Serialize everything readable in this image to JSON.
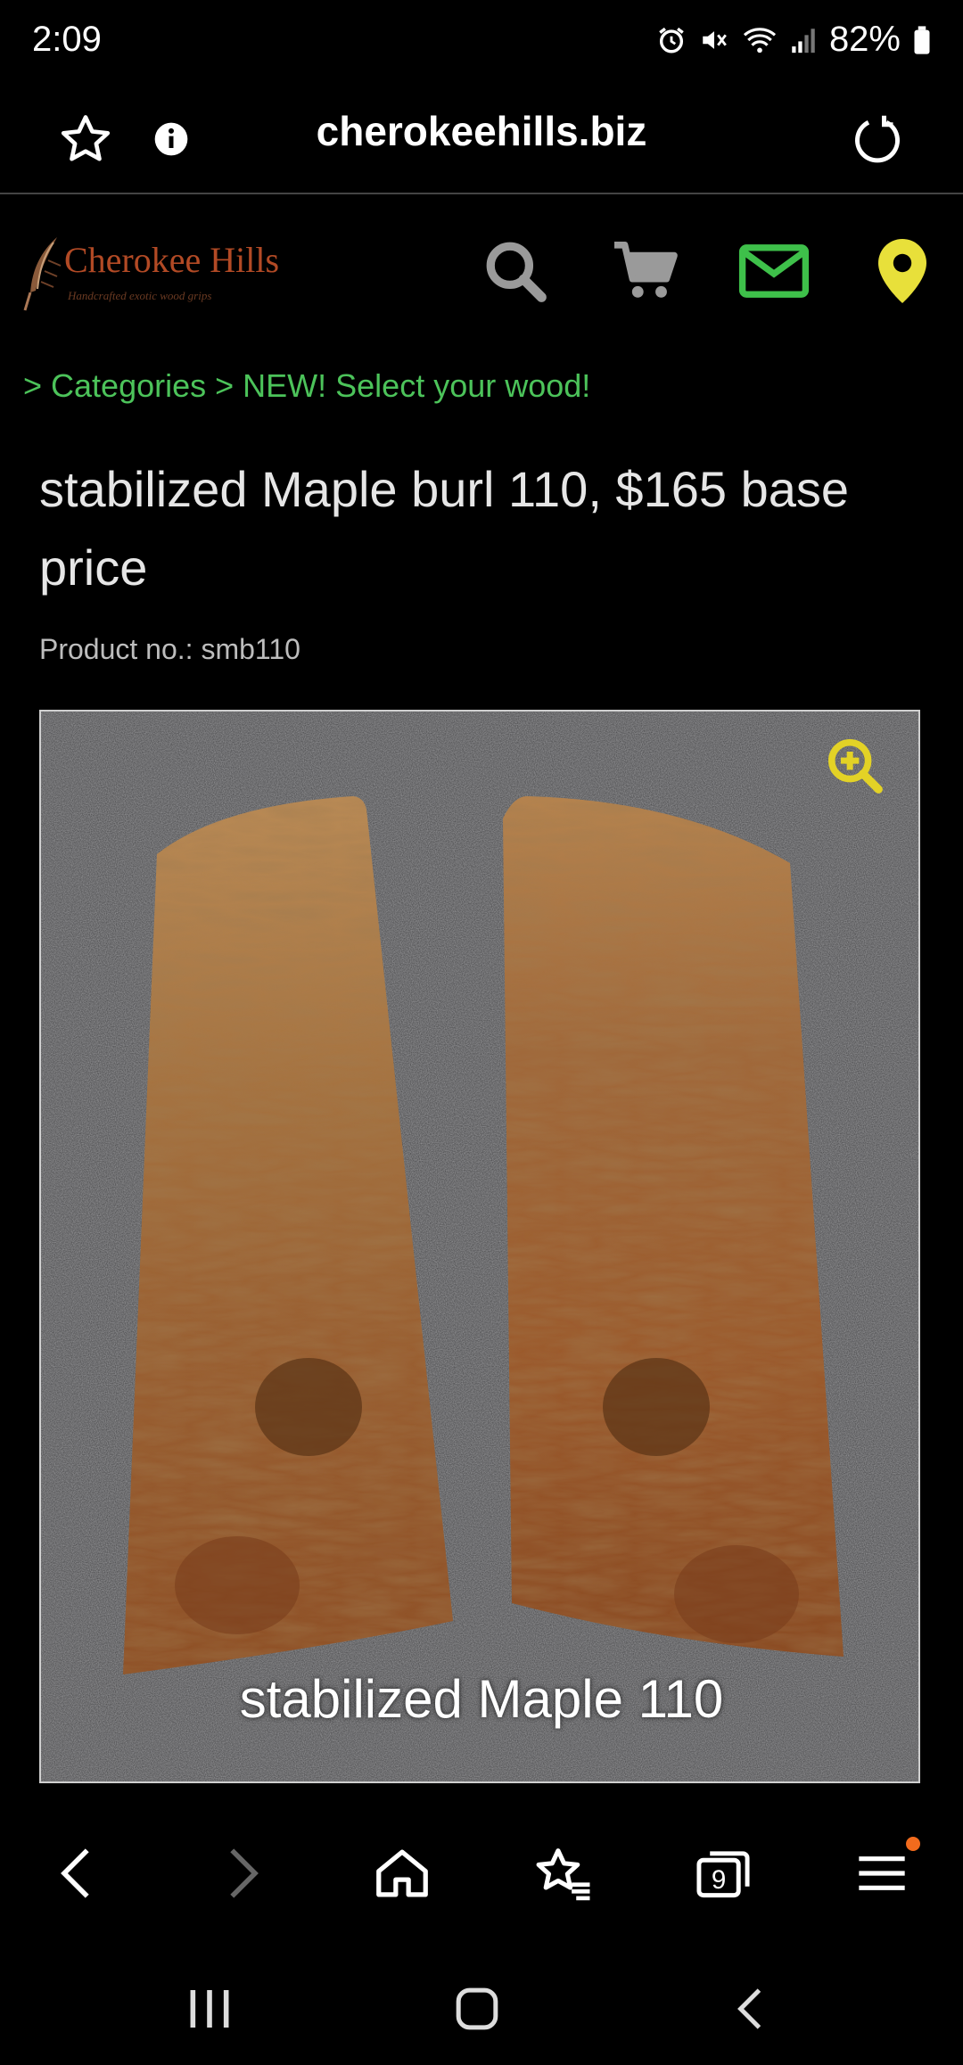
{
  "status_bar": {
    "time": "2:09",
    "battery": "82%"
  },
  "browser": {
    "url": "cherokeehills.biz"
  },
  "site": {
    "logo_title": "Cherokee Hills",
    "logo_subtitle": "Handcrafted exotic wood grips",
    "icon_colors": {
      "search": "#9a9a9a",
      "cart": "#9a9a9a",
      "mail": "#3ec04a",
      "location": "#e8e03a"
    }
  },
  "breadcrumb": {
    "items": [
      "Categories",
      "NEW! Select your wood!"
    ],
    "separator": ">",
    "color": "#4cc35a"
  },
  "product": {
    "title": "stabilized Maple burl 110, $165 base price",
    "number_label": "Product no.: smb110",
    "image_caption": "stabilized Maple 110"
  },
  "browser_nav": {
    "tab_count": "9",
    "menu_badge_color": "#f26b1d"
  }
}
